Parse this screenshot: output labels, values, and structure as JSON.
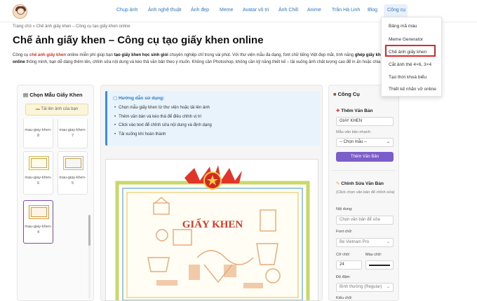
{
  "nav": {
    "items": [
      "Chụp ảnh",
      "Ảnh nghệ thuật",
      "Ảnh đẹp",
      "Meme",
      "Avatar vô tri",
      "Ảnh Chill",
      "Anime",
      "Trần Hà Linh",
      "Blog",
      "Công cụ"
    ],
    "active": "Công cụ"
  },
  "dropdown": {
    "items": [
      "Bảng mã màu",
      "Meme Generator",
      "Chế ảnh giấy khen",
      "Cắt ảnh thẻ 4×6, 3×4",
      "Tạo thời khoá biểu",
      "Thiết kế nhãn vở online"
    ],
    "highlighted": "Chế ảnh giấy khen"
  },
  "breadcrumb": "Trang chủ » Chế ảnh giấy khen – Công cụ tạo giấy khen online",
  "page_title": "Chế ảnh giấy khen – Công cụ tạo giấy khen online",
  "intro": {
    "p1": "Công cụ ",
    "p1_link": "chế ảnh giấy khen",
    "p2": " online miễn phí giúp bạn ",
    "p2_bold": "tạo giấy khen học sinh giỏi",
    "p3": " chuyên nghiệp chỉ trong vài phút. Với thư viện mẫu đa dạng, font chữ tiếng Việt đẹp mắt, tính năng ",
    "p3_bold": "ghép giấy khen online",
    "p4": " thông minh, bạn dễ dàng thêm tên, chỉnh sửa nội dung và kéo thả văn bản theo ý muốn. Không cần Photoshop, không cần kỹ năng thiết kế – tải xuống ảnh chất lượng cao để in ấn hoặc chia sẻ."
  },
  "left_panel": {
    "title": "Chọn Mẫu Giấy Khen",
    "upload_label": "Tải lên ảnh của bạn",
    "templates": [
      {
        "label": "mau-giay-khen-8"
      },
      {
        "label": "mau-giay-khen-7"
      },
      {
        "label": "mau-giay-khen-6"
      },
      {
        "label": "mau-giay-khen-5"
      },
      {
        "label": "mau-giay-khen-4"
      }
    ]
  },
  "guide": {
    "title": "Hướng dẫn sử dụng:",
    "steps": [
      "Chọn mẫu giấy khen từ thư viện hoặc tải lên ảnh",
      "Thêm văn bản và kéo thả để điều chỉnh vị trí",
      "Click vào text để chỉnh sửa nội dung và định dạng",
      "Tải xuống khi hoàn thành"
    ]
  },
  "certificate": {
    "heading": "GIẤY KHEN",
    "colors": {
      "flag": "#e2352a",
      "border": "#c8d86a",
      "text": "#d23a2a",
      "art": "#e8a978"
    }
  },
  "tools": {
    "title": "Công Cụ",
    "add_text": {
      "title": "Thêm Văn Bản",
      "value": "GIAY KHEN",
      "quick_label": "Mẫu văn bản nhanh:",
      "quick_select": "-- Chọn mẫu --",
      "button": "Thêm Văn Bản"
    },
    "edit_text": {
      "title": "Chỉnh Sửa Văn Bản",
      "hint": "(Click chọn văn bản để chỉnh sửa)",
      "content_label": "Nội dung:",
      "content_placeholder": "Chọn văn bản để sửa",
      "font_label": "Font chữ:",
      "font_value": "Be Vietnam Pro",
      "size_label": "Cỡ chữ:",
      "size_value": "24",
      "color_label": "Màu chữ:",
      "weight_label": "Độ đậm:",
      "weight_value": "Bình thường (Regular)",
      "style_label": "Kiểu chữ:"
    }
  }
}
